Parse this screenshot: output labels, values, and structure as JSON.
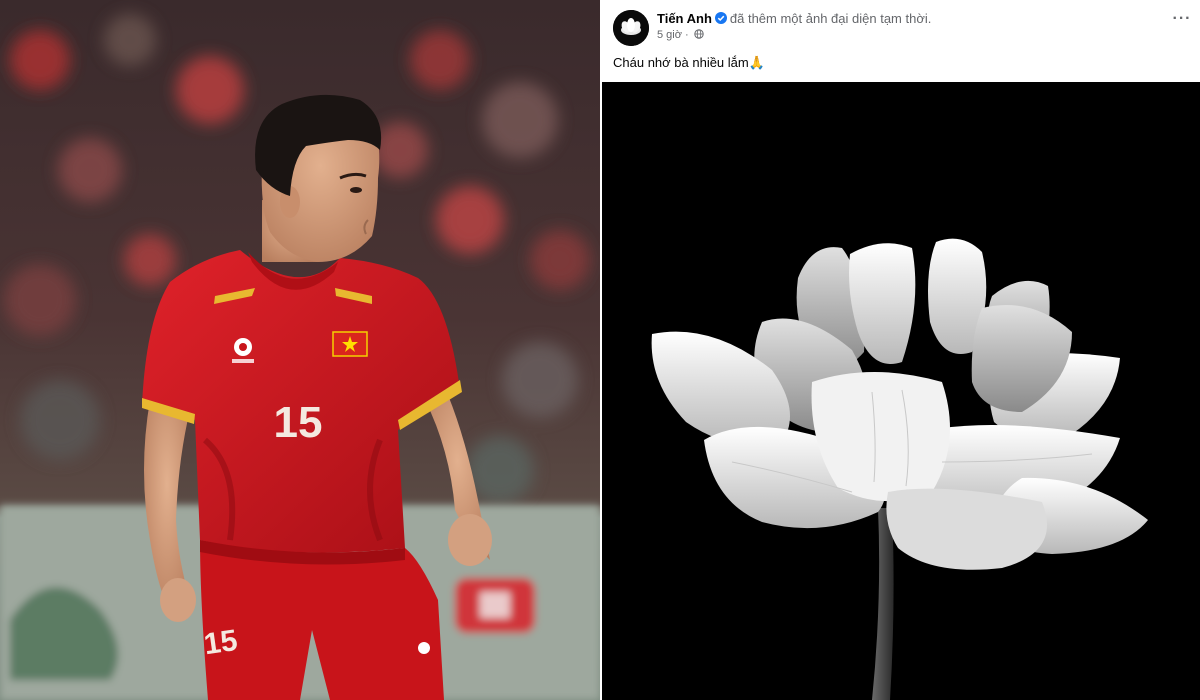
{
  "post": {
    "author_name": "Tiến Anh",
    "action_text": "đã thêm một ảnh đại diện tạm thời.",
    "timestamp": "5 giờ",
    "caption": "Cháu nhớ bà nhiều lắm🙏",
    "more_label": "···",
    "verified_icon": "verified-badge-icon",
    "audience_icon": "globe-icon",
    "colors": {
      "name": "#050505",
      "meta": "#65676b",
      "verified": "#1877f2",
      "image_background": "#000000"
    }
  },
  "left_photo": {
    "jersey_number": "15",
    "shorts_number": "15",
    "colors": {
      "jersey": "#c8141a",
      "trim": "#e8b830"
    }
  }
}
